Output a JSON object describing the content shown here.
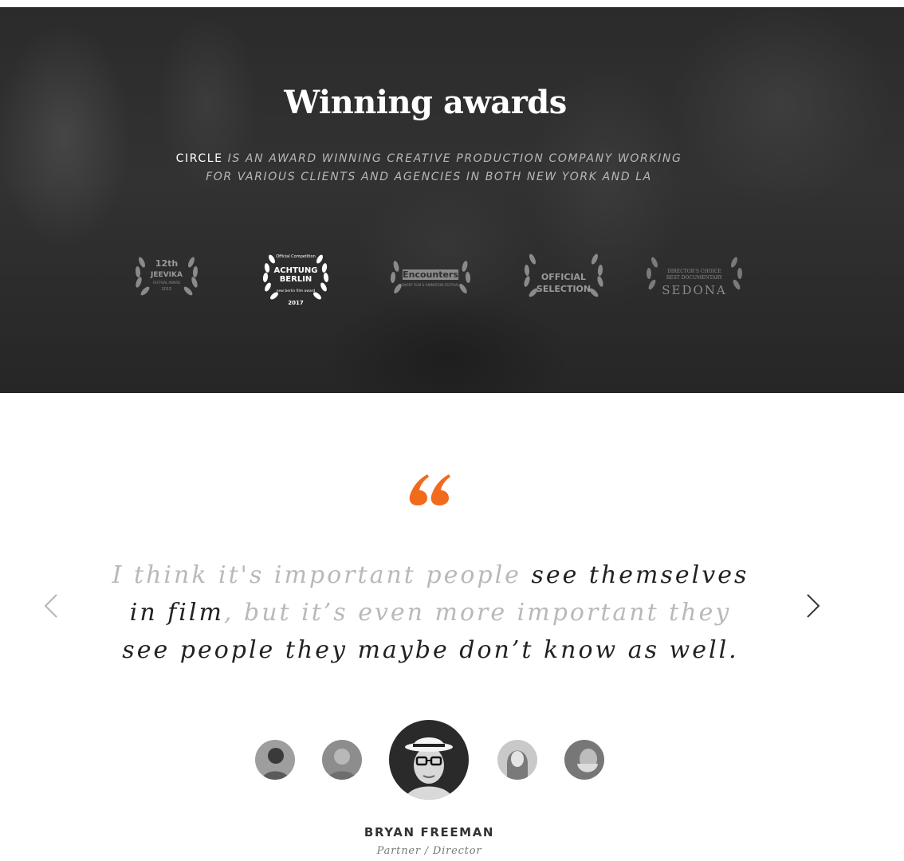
{
  "awards": {
    "title": "Winning awards",
    "subtitle_brand": "CIRCLE",
    "subtitle_line1_rest": " IS AN AWARD WINNING CREATIVE PRODUCTION COMPANY WORKING",
    "subtitle_line2": "FOR VARIOUS CLIENTS AND AGENCIES IN BOTH NEW YORK AND LA",
    "badges": [
      {
        "name": "jeevika-award-icon",
        "line1": "12th",
        "line2": "JEEVIKA",
        "line3": "FESTIVAL AWARD",
        "line4": "2015"
      },
      {
        "name": "achtung-berlin-award-icon",
        "line1": "Official Competition",
        "line2": "ACHTUNG",
        "line3": "BERLIN",
        "line4": "new berlin film award",
        "line5": "2017"
      },
      {
        "name": "encounters-award-icon",
        "line1": "Encounters",
        "line2": "SHORT FILM & ANIMATION FESTIVAL"
      },
      {
        "name": "official-selection-award-icon",
        "line1": "OFFICIAL",
        "line2": "SELECTION"
      },
      {
        "name": "sedona-award-icon",
        "line1": "DIRECTOR'S CHOICE",
        "line2": "BEST DOCUMENTARY",
        "line3": "SEDONA"
      }
    ]
  },
  "testimonial": {
    "quote_muted_1": "I think it's important people ",
    "quote_strong_1": "see themselves in film",
    "quote_muted_2": ", but it’s even more important they ",
    "quote_strong_2": "see people they maybe don’t know as well.",
    "accent_color": "#f26a1b",
    "person_name": "BRYAN FREEMAN",
    "person_role": "Partner / Director",
    "prev_icon": "chevron-left-icon",
    "next_icon": "chevron-right-icon"
  }
}
